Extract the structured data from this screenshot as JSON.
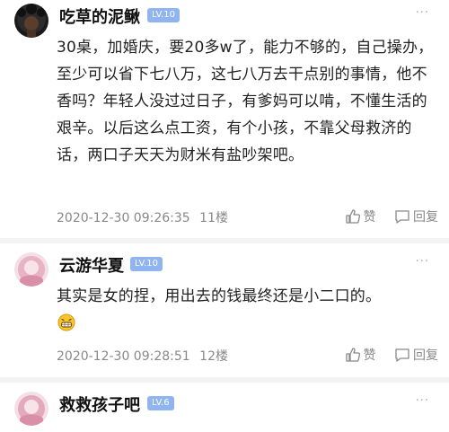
{
  "comments": [
    {
      "username": "吃草的泥鳅",
      "level": "LV.10",
      "text": "30桌，加婚庆，要20多w了，能力不够的，自己操办，至少可以省下七八万，这七八万去干点别的事情，他不香吗？年轻人没过过日子，有爹妈可以啃，不懂生活的艰辛。以后这么点工资，有个小孩，不靠父母救济的话，两口子天天为财米有盐吵架吧。",
      "time": "2020-12-30 09:26:35",
      "floor": "11楼",
      "like_label": "赞",
      "reply_label": "回复"
    },
    {
      "username": "云游华夏",
      "level": "LV.10",
      "text": "其实是女的捏，用出去的钱最终还是小二口的。",
      "time": "2020-12-30 09:28:51",
      "floor": "12楼",
      "like_label": "赞",
      "reply_label": "回复"
    },
    {
      "username": "救救孩子吧",
      "level": "LV.6"
    }
  ],
  "more_glyph": "···",
  "colors": {
    "level_badge": "#8fb4ef",
    "meta_text": "#888888"
  }
}
